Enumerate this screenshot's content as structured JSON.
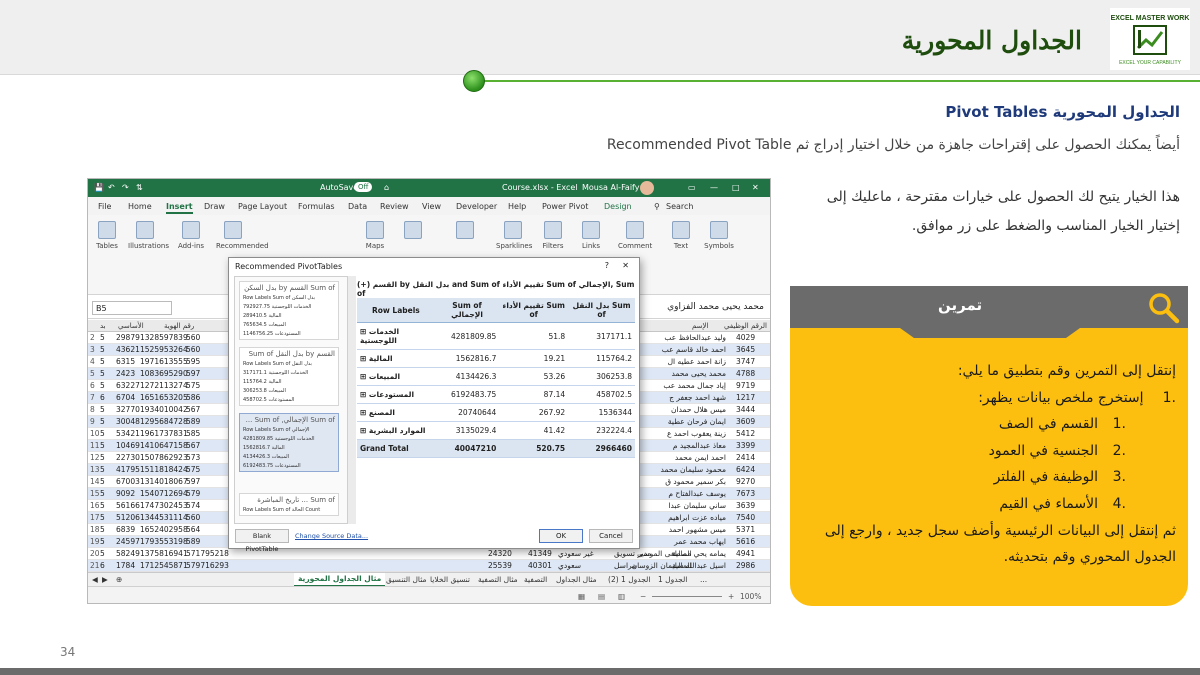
{
  "slide": {
    "title": "الجداول المحورية",
    "section_title": "الجداول المحورية Pivot Tables",
    "intro": "أيضاً يمكنك الحصول على إقتراحات جاهزة من خلال اختيار إدراج ثم Recommended Pivot Table",
    "desc": "هذا الخيار يتيح لك الحصول على خيارات مقترحة ، ماعليك إلى إختيار الخيار المناسب والضغط على زر موافق.",
    "page_number": "34",
    "logo_text": "EXCEL MASTER WORK",
    "logo_tagline": "EXCEL YOUR CAPABILITY"
  },
  "exercise": {
    "heading": "تمرين",
    "lead": "إنتقل إلى التمرين وقم بتطبيق ما يلي:",
    "step1": "إستخرج ملخص بيانات يظهر:",
    "step1_num": ".1",
    "sub_items": [
      {
        "num": ".1",
        "text": "القسم في الصف"
      },
      {
        "num": ".2",
        "text": "الجنسية في العمود"
      },
      {
        "num": ".3",
        "text": "الوظيفة في الفلتر"
      },
      {
        "num": ".4",
        "text": "الأسماء في القيم"
      }
    ],
    "closing": "ثم إنتقل إلى البيانات الرئيسية وأضف سجل جديد ، وارجع إلى الجدول المحوري وقم بتحديثه."
  },
  "excel": {
    "autosave": "AutoSave",
    "autosave_state": "Off",
    "file_name": "Course.xlsx - Excel",
    "user": "Mousa Al-Faify",
    "menu": [
      "File",
      "Home",
      "Insert",
      "Draw",
      "Page Layout",
      "Formulas",
      "Data",
      "Review",
      "View",
      "Developer",
      "Help",
      "Power Pivot",
      "Design"
    ],
    "search_label": "Search",
    "ribbon": [
      "Tables",
      "Illustrations",
      "Add-ins",
      "Recommended",
      "",
      "Maps",
      "",
      "",
      "Sparklines",
      "Filters",
      "Links",
      "Comment",
      "Text",
      "Symbols"
    ],
    "name_box": "B5",
    "formula": "محمد يحيى محمد الفزاوي",
    "grid_headers": [
      "بد",
      "الأساسي",
      "رقم الهوية",
      "الإسم",
      "الرقم الوظيفي"
    ],
    "rows": [
      {
        "r": "2",
        "a": "5",
        "b": "29879",
        "c": "1328597839",
        "d": "560",
        "name": "وليد عبدالحافظ عب",
        "id": "4029"
      },
      {
        "r": "3",
        "a": "5",
        "b": "43621",
        "c": "1525953264",
        "d": "560",
        "name": "احمد خالد قاسم عب",
        "id": "3645"
      },
      {
        "r": "4",
        "a": "5",
        "b": "6315",
        "c": "1971613555",
        "d": "595",
        "name": "زانة احمد عطيه ال",
        "id": "3747"
      },
      {
        "r": "5",
        "a": "5",
        "b": "2423",
        "c": "1083695290",
        "d": "597",
        "name": "محمد يحيى محمد",
        "id": "4788"
      },
      {
        "r": "6",
        "a": "5",
        "b": "63227",
        "c": "1272113274",
        "d": "575",
        "name": "إياد جمال محمد عب",
        "id": "9719"
      },
      {
        "r": "7",
        "a": "6",
        "b": "6704",
        "c": "1651653205",
        "d": "586",
        "name": "شهد احمد جعفر ج",
        "id": "1217"
      },
      {
        "r": "8",
        "a": "5",
        "b": "32770",
        "c": "1934010042",
        "d": "567",
        "name": "ميس هلال حمدان",
        "id": "3444"
      },
      {
        "r": "9",
        "a": "5",
        "b": "30048",
        "c": "1295684728",
        "d": "589",
        "name": "ايمان فرحان عطية",
        "id": "3609"
      },
      {
        "r": "10",
        "a": "5",
        "b": "53421",
        "c": "1961737831",
        "d": "585",
        "name": "زينة يعقوب احمد ع",
        "id": "5412"
      },
      {
        "r": "11",
        "a": "5",
        "b": "10469",
        "c": "1410647158",
        "d": "567",
        "name": "معاذ عبدالمجيد م",
        "id": "3399"
      },
      {
        "r": "12",
        "a": "5",
        "b": "22730",
        "c": "1507862923",
        "d": "573",
        "name": "احمد ايمن محمد",
        "id": "2414"
      },
      {
        "r": "13",
        "a": "5",
        "b": "41795",
        "c": "1511818424",
        "d": "575",
        "name": "محمود سليمان محمد",
        "id": "6424"
      },
      {
        "r": "14",
        "a": "5",
        "b": "67003",
        "c": "1314018067",
        "d": "597",
        "name": "بكر سمير محمود ق",
        "id": "9270"
      },
      {
        "r": "15",
        "a": "5",
        "b": "9092",
        "c": "1540712694",
        "d": "579",
        "name": "يوسف عبدالفتاح م",
        "id": "7673"
      },
      {
        "r": "16",
        "a": "5",
        "b": "56166",
        "c": "1747302453",
        "d": "574",
        "name": "ساني سليمان عبدا",
        "id": "3639"
      },
      {
        "r": "17",
        "a": "5",
        "b": "51206",
        "c": "1344531114",
        "d": "560",
        "name": "مياده عزت ابراهيم",
        "id": "7540"
      },
      {
        "r": "18",
        "a": "5",
        "b": "6839",
        "c": "1652402958",
        "d": "564",
        "name": "ميس مشهور احمد",
        "id": "5371"
      },
      {
        "r": "19",
        "a": "5",
        "b": "24597",
        "c": "1793553198",
        "d": "589",
        "name": "ايهاب محمد عمر",
        "id": "5616"
      },
      {
        "r": "20",
        "a": "5",
        "b": "58249",
        "c": "1375816941",
        "d": "571795218",
        "name": "يمامه يحي مصطفى الموسى",
        "id": "4941",
        "dept": "المالية",
        "job": "مدير تسويق",
        "sal": "41349",
        "x": "24320",
        "nat": "غير سعودي"
      },
      {
        "r": "21",
        "a": "6",
        "b": "1784",
        "c": "1712545871",
        "d": "579716293",
        "name": "اسيل عبدالله سليمان الزوسان",
        "id": "2986",
        "dept": "المالية",
        "job": "مراسل",
        "sal": "40301",
        "x": "25539",
        "nat": "سعودي"
      }
    ],
    "sheets": [
      "مثال الجداول المحورية",
      "مثال التنسيق",
      "تنسيق الخلايا",
      "مثال التصفية",
      "التصفية",
      "مثال الجداول",
      "الجدول 1 (2)",
      "الجدول 1",
      "..."
    ],
    "zoom": "100%",
    "dialog": {
      "title": "Recommended PivotTables",
      "help": "?",
      "close": "✕",
      "thumbs": [
        {
          "cap": "Sum of القسم by بدل السكن",
          "rows": [
            "Row Labels  Sum of بدل السكن",
            "الخدمات اللوجستية  792927.75",
            "المالية  289410.5",
            "المبيعات  765634.5",
            "المستودعات  1146756.25"
          ]
        },
        {
          "cap": "القسم by بدل النقل Sum of",
          "rows": [
            "Row Labels  Sum of بدل النقل",
            "الخدمات اللوجستية  317171.1",
            "المالية  115764.2",
            "المبيعات  306253.8",
            "المستودعات  458702.5"
          ]
        },
        {
          "cap": "Sum of الإجمالي, Sum of ...",
          "rows": [
            "Row Labels  Sum of الإجمالي",
            "الخدمات اللوجستية  4281809.85",
            "المالية  1562816.7",
            "المبيعات  4134426.3",
            "المستودعات  6192483.75"
          ]
        },
        {
          "cap": "Sum of ... تاريخ المباشرة",
          "rows": [
            "Row Labels  Sum of الحالة  Count"
          ]
        }
      ],
      "preview_title": "(+) القسم by بدل النقل and Sum of تقييم الأداء Sum of الإجمالي, Sum of",
      "table_headers": [
        "Row Labels",
        "Sum of الإجمالي",
        "تقييم الأداء Sum of",
        "بدل النقل Sum of"
      ],
      "table_rows": [
        {
          "label": "الخدمات اللوجستية",
          "total": "4281809.85",
          "rating": "51.8",
          "transport": "317171.1"
        },
        {
          "label": "المالية",
          "total": "1562816.7",
          "rating": "19.21",
          "transport": "115764.2"
        },
        {
          "label": "المبيعات",
          "total": "4134426.3",
          "rating": "53.26",
          "transport": "306253.8"
        },
        {
          "label": "المستودعات",
          "total": "6192483.75",
          "rating": "87.14",
          "transport": "458702.5"
        },
        {
          "label": "المصنع",
          "total": "20740644",
          "rating": "267.92",
          "transport": "1536344"
        },
        {
          "label": "الموارد البشرية",
          "total": "3135029.4",
          "rating": "41.42",
          "transport": "232224.4"
        }
      ],
      "grand_total": {
        "label": "Grand Total",
        "total": "40047210",
        "rating": "520.75",
        "transport": "2966460"
      },
      "blank_btn": "Blank PivotTable",
      "source_link": "Change Source Data...",
      "ok": "OK",
      "cancel": "Cancel"
    }
  },
  "colors": {
    "title_green": "#1e4d0e",
    "accent_green": "#58b130",
    "excel_green": "#217346",
    "exercise_yellow": "#fcbf10",
    "exercise_head": "#6b6b6b"
  }
}
